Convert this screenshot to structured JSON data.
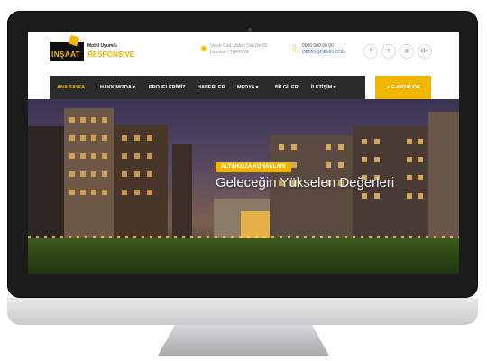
{
  "header": {
    "logo": {
      "brand": "İNŞAAT",
      "tagline": "Mobil Uyumlu",
      "name": "RESPONSIVE"
    },
    "address": {
      "line1": "Vatan Cad. Vatan Sok No:00",
      "line2": "İstanbul / TÜRKİYE"
    },
    "contact": {
      "phone": "0000 000 00 00",
      "email": "DEMO@DEMO.COM"
    },
    "social": [
      {
        "icon": "facebook-icon",
        "glyph": "f"
      },
      {
        "icon": "twitter-icon",
        "glyph": "t"
      },
      {
        "icon": "instagram-icon",
        "glyph": "◎"
      },
      {
        "icon": "google-plus-icon",
        "glyph": "G+"
      }
    ]
  },
  "nav": {
    "items": [
      {
        "label": "ANA SAYFA",
        "active": true
      },
      {
        "label": "HAKKIMIZDA ▾"
      },
      {
        "label": "PROJELERİMİZ"
      },
      {
        "label": "HABERLER"
      },
      {
        "label": "MEDYA ▾"
      },
      {
        "label": "BİLGİLER"
      },
      {
        "label": "İLETİŞİM ▾"
      }
    ],
    "catalog_button": "➚ E-KATALOG"
  },
  "hero": {
    "tag": "ALTINKOZA KONAKLARI",
    "title": "Geleceğin Yükselen Değerleri"
  },
  "colors": {
    "accent": "#f2b600",
    "nav_bg": "#2b2b2b"
  }
}
